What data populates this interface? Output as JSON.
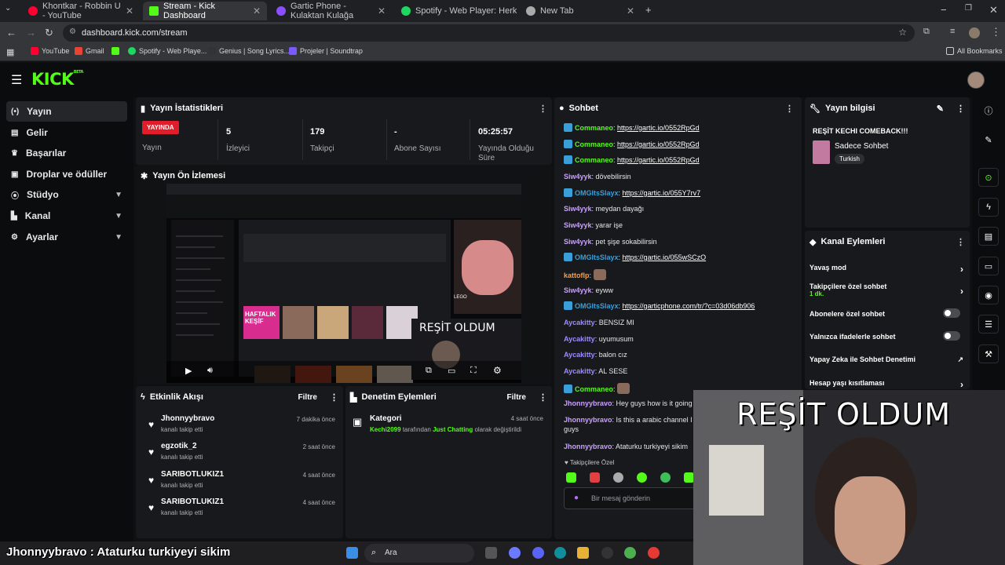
{
  "browser": {
    "tabs": [
      {
        "title": "Khontkar - Robbin U - YouTube",
        "color": "#ff0033"
      },
      {
        "title": "Stream - Kick Dashboard",
        "color": "#53fc18"
      },
      {
        "title": "Gartic Phone - Kulaktan Kulağa",
        "color": "#8a4fff"
      },
      {
        "title": "Spotify - Web Player: Herkes iç",
        "color": "#1ed760"
      },
      {
        "title": "New Tab",
        "color": "#aaaaaa"
      }
    ],
    "url": "dashboard.kick.com/stream",
    "bookmarks": [
      {
        "label": "YouTube",
        "color": "#ff0033"
      },
      {
        "label": "Gmail",
        "color": "#ea4335"
      },
      {
        "label": "",
        "color": "#53fc18"
      },
      {
        "label": "Spotify - Web Playe...",
        "color": "#1ed760"
      },
      {
        "label": "Genius | Song Lyrics...",
        "color": "#ffff64"
      },
      {
        "label": "Projeler | Soundtrap",
        "color": "#7a5af8"
      }
    ],
    "all_bookmarks": "All Bookmarks"
  },
  "brand": {
    "logo": "KICK",
    "beta": "BETA"
  },
  "sidebar": {
    "items": [
      {
        "label": "Yayın",
        "icon": "broadcast-icon"
      },
      {
        "label": "Gelir",
        "icon": "revenue-icon"
      },
      {
        "label": "Başarılar",
        "icon": "trophy-icon"
      },
      {
        "label": "Droplar ve ödüller",
        "icon": "gift-icon"
      },
      {
        "label": "Stüdyo",
        "icon": "studio-icon"
      },
      {
        "label": "Kanal",
        "icon": "channel-icon"
      },
      {
        "label": "Ayarlar",
        "icon": "gear-icon"
      }
    ]
  },
  "stats": {
    "title": "Yayın İstatistikleri",
    "live_badge": "YAYINDA",
    "items": [
      {
        "value": "",
        "label": "Yayın"
      },
      {
        "value": "5",
        "label": "İzleyici"
      },
      {
        "value": "179",
        "label": "Takipçi"
      },
      {
        "value": "-",
        "label": "Abone Sayısı"
      },
      {
        "value": "05:25:57",
        "label": "Yayında Olduğu Süre"
      }
    ]
  },
  "preview": {
    "title": "Yayın Ön İzlemesi",
    "overlay_text": "REŞİT OLDUM",
    "inner_labels": [
      "HAFTALIK KEŞİF",
      "LEGO"
    ]
  },
  "activity": {
    "title": "Etkinlik Akışı",
    "filter": "Filtre",
    "items": [
      {
        "name": "Jhonnyybravo",
        "sub": "kanalı takip etti",
        "time": "7 dakika önce"
      },
      {
        "name": "egzotik_2",
        "sub": "kanalı takip etti",
        "time": "2 saat önce"
      },
      {
        "name": "SARIBOTLUKIZ1",
        "sub": "kanalı takip etti",
        "time": "4 saat önce"
      },
      {
        "name": "SARIBOTLUKIZ1",
        "sub": "kanalı takip etti",
        "time": "4 saat önce"
      }
    ]
  },
  "moderation": {
    "title": "Denetim Eylemleri",
    "filter": "Filtre",
    "item": {
      "label": "Kategori",
      "time": "4 saat önce",
      "user": "Kechi2099",
      "mid": "tarafından",
      "category": "Just Chatting",
      "tail": "olarak değiştirildi"
    }
  },
  "chat": {
    "title": "Sohbet",
    "messages": [
      {
        "user": "Commaneo",
        "text": "https://gartic.io/0552RpGd",
        "color": "#53fc18",
        "badge": true,
        "link": true
      },
      {
        "user": "Commaneo",
        "text": "https://gartic.io/0552RpGd",
        "color": "#53fc18",
        "badge": true,
        "link": true
      },
      {
        "user": "Commaneo",
        "text": "https://gartic.io/0552RpGd",
        "color": "#53fc18",
        "badge": true,
        "link": true
      },
      {
        "user": "Siw4yyk",
        "text": "dövebilirsin",
        "color": "#c9a0ff",
        "badge": false,
        "link": false
      },
      {
        "user": "OMGItsSlayx",
        "text": "https://gartic.io/055Y7rv7",
        "color": "#3a9fd8",
        "badge": true,
        "link": true
      },
      {
        "user": "Siw4yyk",
        "text": "meydan dayağı",
        "color": "#c9a0ff",
        "badge": false,
        "link": false
      },
      {
        "user": "Siw4yyk",
        "text": "yarar işe",
        "color": "#c9a0ff",
        "badge": false,
        "link": false
      },
      {
        "user": "Siw4yyk",
        "text": "pet şişe sokabilirsin",
        "color": "#c9a0ff",
        "badge": false,
        "link": false
      },
      {
        "user": "OMGItsSlayx",
        "text": "https://gartic.io/055wSCzO",
        "color": "#3a9fd8",
        "badge": true,
        "link": true
      },
      {
        "user": "kattoflp",
        "text": "",
        "color": "#ff9e3d",
        "badge": false,
        "link": false,
        "emote": true
      },
      {
        "user": "Siw4yyk",
        "text": "eyww",
        "color": "#c9a0ff",
        "badge": false,
        "link": false
      },
      {
        "user": "OMGItsSlayx",
        "text": "https://garticphone.com/tr/?c=03d06db906",
        "color": "#3a9fd8",
        "badge": true,
        "link": true
      },
      {
        "user": "Aycakitty",
        "text": "BENSIZ MI",
        "color": "#9d8cff",
        "badge": false,
        "link": false
      },
      {
        "user": "Aycakitty",
        "text": "uyumusum",
        "color": "#9d8cff",
        "badge": false,
        "link": false
      },
      {
        "user": "Aycakitty",
        "text": "balon cız",
        "color": "#9d8cff",
        "badge": false,
        "link": false
      },
      {
        "user": "Aycakitty",
        "text": "AL SESE",
        "color": "#9d8cff",
        "badge": false,
        "link": false
      },
      {
        "user": "Commaneo",
        "text": "",
        "color": "#53fc18",
        "badge": true,
        "link": false,
        "emote": true
      },
      {
        "user": "Jhonnyybravo",
        "text": "Hey guys how is it going",
        "color": "#c9a0ff",
        "badge": false,
        "link": false
      },
      {
        "user": "Jhonnyybravo",
        "text": "Is this a arabic channel I",
        "color": "#c9a0ff",
        "badge": false,
        "link": false
      },
      {
        "user": "",
        "text": "guys",
        "color": "#c9a0ff",
        "badge": false,
        "link": false
      },
      {
        "user": "Jhonnyybravo",
        "text": "Ataturku turkiyeyi sikim",
        "color": "#c9a0ff",
        "badge": false,
        "link": false
      }
    ],
    "followers_only": "Takipçilere Özel",
    "placeholder": "Bir mesaj gönderin"
  },
  "stream_info": {
    "title": "Yayın bilgisi",
    "stream_title": "REŞİT KECHI COMEBACK!!!",
    "category": "Sadece Sohbet",
    "tag": "Turkish"
  },
  "channel_actions": {
    "title": "Kanal Eylemleri",
    "items": [
      {
        "label": "Yavaş mod",
        "sub": "",
        "control": "arrow"
      },
      {
        "label": "Takipçilere özel sohbet",
        "sub": "1 dk.",
        "control": "arrow"
      },
      {
        "label": "Abonelere özel sohbet",
        "sub": "",
        "control": "toggle"
      },
      {
        "label": "Yalnızca ifadelerle sohbet",
        "sub": "",
        "control": "toggle"
      },
      {
        "label": "Yapay Zeka ile Sohbet Denetimi",
        "sub": "",
        "control": "external"
      },
      {
        "label": "Hesap yaşı kısıtlaması",
        "sub": "",
        "control": "arrow"
      }
    ]
  },
  "webcam": {
    "overlay_text": "REŞİT OLDUM"
  },
  "taskbar": {
    "subtitle_user": "Jhonnyybravo",
    "subtitle_sep": ":",
    "subtitle_text": "Ataturku turkiyeyi sikim",
    "search": "Ara"
  }
}
